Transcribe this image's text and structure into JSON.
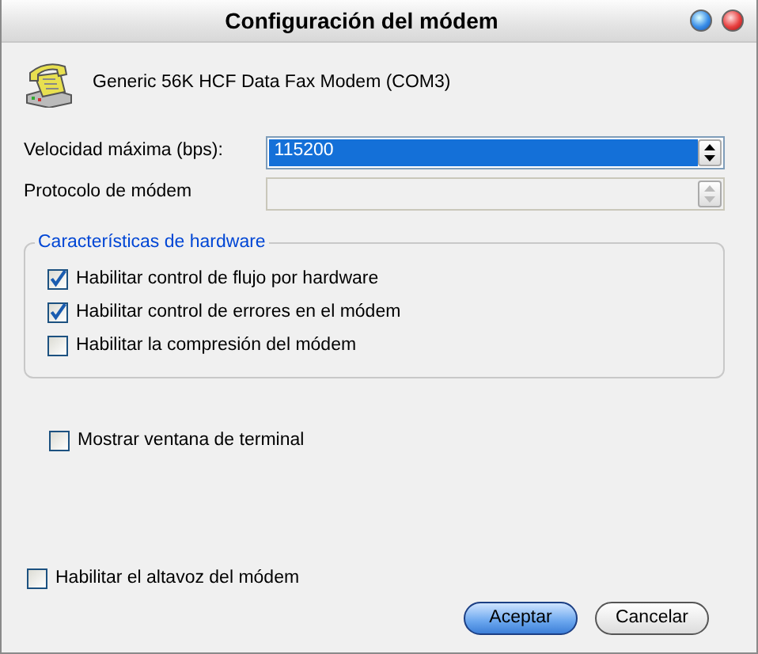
{
  "window": {
    "title": "Configuración del módem"
  },
  "device": {
    "name": "Generic 56K HCF Data Fax Modem (COM3)"
  },
  "fields": [
    {
      "label": "Velocidad máxima (bps):",
      "value": "115200",
      "disabled": false
    },
    {
      "label": "Protocolo de módem",
      "disabled": true
    }
  ],
  "hardware": {
    "title": "Características de hardware",
    "options": [
      {
        "label": "Habilitar control de flujo por hardware",
        "checked": true
      },
      {
        "label": "Habilitar control de errores en el módem",
        "checked": true
      },
      {
        "label": "Habilitar la compresión del módem",
        "checked": false
      }
    ]
  },
  "terminal": {
    "label": "Mostrar ventana de terminal",
    "checked": false
  },
  "speaker": {
    "label": "Habilitar el altavoz del módem",
    "checked": false
  },
  "buttons": [
    {
      "label": "Aceptar",
      "default": true
    },
    {
      "label": "Cancelar",
      "default": false
    }
  ]
}
